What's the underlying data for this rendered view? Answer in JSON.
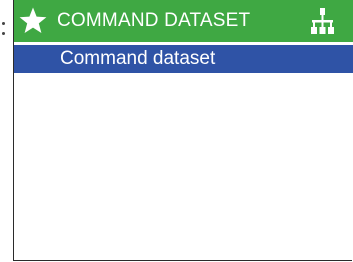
{
  "header": {
    "title": "COMMAND DATASET",
    "left_icon": "star-icon",
    "right_icon": "hierarchy-icon"
  },
  "menu": {
    "items": [
      {
        "label": "Command dataset",
        "selected": true
      }
    ]
  },
  "colors": {
    "header_bg": "#3fa843",
    "selected_bg": "#2f53a6",
    "text_light": "#ffffff",
    "frame": "#2b2b2b"
  }
}
